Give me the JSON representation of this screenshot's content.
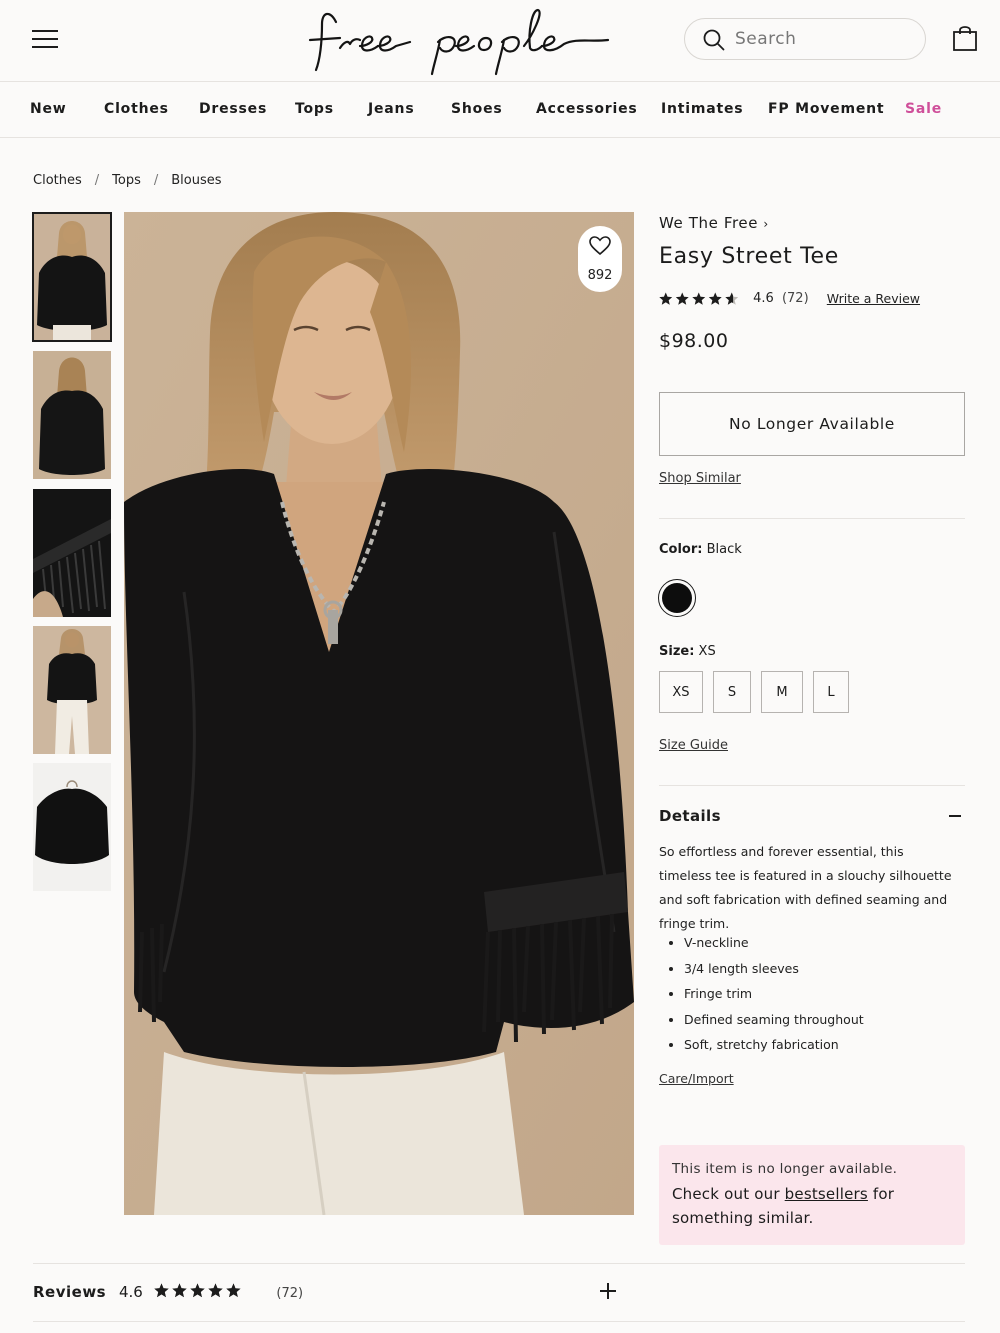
{
  "header": {
    "brand_logo": "free people",
    "search_placeholder": "Search",
    "icons": [
      "menu-icon",
      "search-icon",
      "shopping-bag-icon"
    ]
  },
  "nav": {
    "items": [
      "New",
      "Clothes",
      "Dresses",
      "Tops",
      "Jeans",
      "Shoes",
      "Accessories",
      "Intimates",
      "FP Movement",
      "Sale"
    ],
    "sale_color": "#cf4f9a"
  },
  "breadcrumb": {
    "items": [
      "Clothes",
      "Tops",
      "Blouses"
    ],
    "separator": "/"
  },
  "favorite": {
    "count": "892"
  },
  "product": {
    "brand": "We The Free",
    "brand_arrow": "›",
    "name": "Easy Street Tee",
    "rating_value": "4.6",
    "rating_stars": 4.6,
    "review_count": "(72)",
    "write_review": "Write a Review",
    "price": "$98.00",
    "availability_button": "No Longer Available",
    "shop_similar": "Shop Similar",
    "color_label": "Color:",
    "color_value": "Black",
    "color_swatch": "#0d0d0d",
    "size_label": "Size:",
    "size_value": "XS",
    "sizes": [
      "XS",
      "S",
      "M",
      "L"
    ],
    "size_guide": "Size Guide"
  },
  "details": {
    "heading": "Details",
    "description": "So effortless and forever essential, this timeless tee is featured in a slouchy silhouette and soft fabrication with defined seaming and fringe trim.",
    "bullets": [
      "V-neckline",
      "3/4 length sleeves",
      "Fringe trim",
      "Defined seaming throughout",
      "Soft, stretchy fabrication"
    ],
    "care_link": "Care/Import"
  },
  "notice": {
    "line1": "This item is no longer available.",
    "line2_pre": "Check out our",
    "line2_link": "bestsellers",
    "line2_post": "for something similar.",
    "background": "#fbe6ec"
  },
  "reviews": {
    "heading": "Reviews",
    "rating_value": "4.6",
    "count": "(72)"
  }
}
